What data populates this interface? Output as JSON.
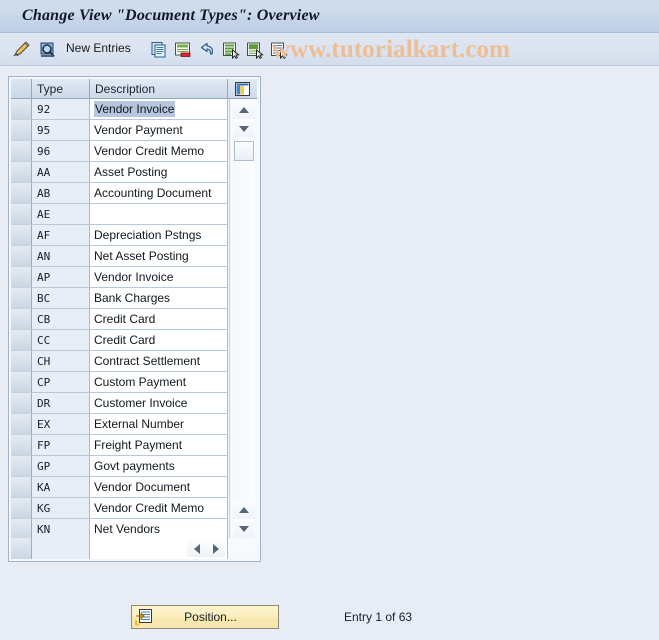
{
  "window": {
    "title": "Change View \"Document Types\": Overview"
  },
  "toolbar": {
    "icons": [
      {
        "name": "change-pencil-icon",
        "title": "Change"
      },
      {
        "name": "display-magnifier-icon",
        "title": "Display"
      }
    ],
    "new_entries_label": "New Entries",
    "action_icons": [
      {
        "name": "copy-icon",
        "title": "Copy As"
      },
      {
        "name": "delete-icon",
        "title": "Delete"
      },
      {
        "name": "undo-icon",
        "title": "Undo Change"
      },
      {
        "name": "select-all-icon",
        "title": "Select All"
      },
      {
        "name": "select-block-icon",
        "title": "Select Block"
      },
      {
        "name": "deselect-all-icon",
        "title": "Deselect All"
      }
    ]
  },
  "watermark": {
    "text": "www.tutorialkart.com",
    "color": "#edbe93"
  },
  "grid": {
    "columns": [
      "Type",
      "Description"
    ],
    "config_icon": "table-settings-icon",
    "selected_row_index": 0,
    "rows": [
      {
        "type": "92",
        "description": "Vendor Invoice"
      },
      {
        "type": "95",
        "description": "Vendor Payment"
      },
      {
        "type": "96",
        "description": "Vendor Credit Memo"
      },
      {
        "type": "AA",
        "description": "Asset Posting"
      },
      {
        "type": "AB",
        "description": "Accounting Document"
      },
      {
        "type": "AE",
        "description": ""
      },
      {
        "type": "AF",
        "description": "Depreciation Pstngs"
      },
      {
        "type": "AN",
        "description": "Net Asset Posting"
      },
      {
        "type": "AP",
        "description": "Vendor Invoice"
      },
      {
        "type": "BC",
        "description": "Bank Charges"
      },
      {
        "type": "CB",
        "description": "Credit Card"
      },
      {
        "type": "CC",
        "description": "Credit Card"
      },
      {
        "type": "CH",
        "description": "Contract Settlement"
      },
      {
        "type": "CP",
        "description": "Custom Payment"
      },
      {
        "type": "DR",
        "description": "Customer Invoice"
      },
      {
        "type": "EX",
        "description": "External Number"
      },
      {
        "type": "FP",
        "description": "Freight Payment"
      },
      {
        "type": "GP",
        "description": "Govt payments"
      },
      {
        "type": "KA",
        "description": "Vendor Document"
      },
      {
        "type": "KG",
        "description": "Vendor Credit Memo"
      },
      {
        "type": "KN",
        "description": "Net Vendors"
      }
    ]
  },
  "footer": {
    "position_button_label": "Position...",
    "position_button_icon": "position-goto-icon",
    "entry_status": "Entry 1 of 63"
  }
}
